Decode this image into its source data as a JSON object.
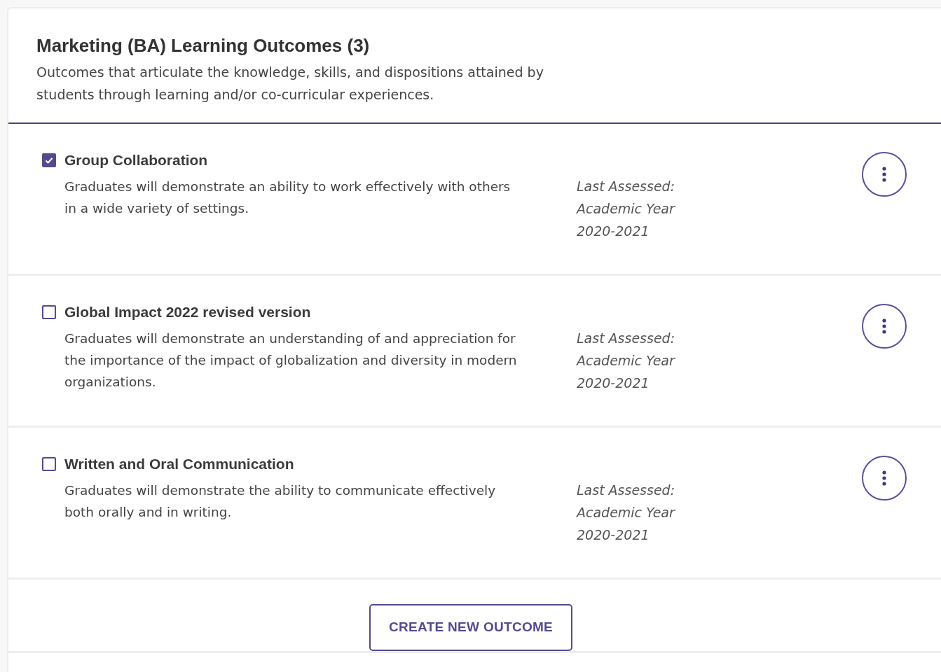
{
  "header": {
    "title": "Marketing (BA) Learning Outcomes (3)",
    "description": "Outcomes that articulate the knowledge, skills, and dispositions attained by students through learning and/or co-curricular experiences."
  },
  "outcomes": [
    {
      "title": "Group Collaboration",
      "checked": true,
      "description": "Graduates will demonstrate an ability to work effectively with others in a wide variety of settings.",
      "last_assessed": "Last Assessed: Academic Year 2020-2021"
    },
    {
      "title": "Global Impact 2022 revised version",
      "checked": false,
      "description": "Graduates will demonstrate an understanding of and appreciation for the importance of the impact of globalization and diversity in modern organizations.",
      "last_assessed": "Last Assessed: Academic Year 2020-2021"
    },
    {
      "title": "Written and Oral Communication",
      "checked": false,
      "description": "Graduates will demonstrate the ability to communicate effectively both orally and in writing.",
      "last_assessed": "Last Assessed: Academic Year 2020-2021"
    }
  ],
  "create_button": "CREATE NEW OUTCOME"
}
